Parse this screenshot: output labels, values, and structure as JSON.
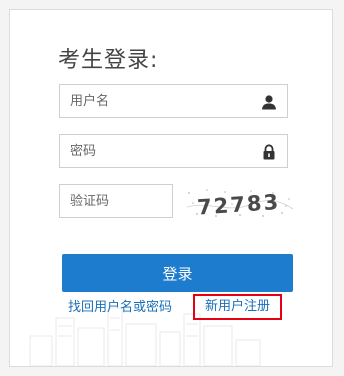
{
  "login": {
    "title": "考生登录:",
    "username_placeholder": "用户名",
    "password_placeholder": "密码",
    "captcha_placeholder": "验证码",
    "captcha_text": "72783",
    "submit_label": "登录",
    "find_account_label": "找回用户名或密码",
    "register_label": "新用户注册"
  },
  "colors": {
    "primary": "#1d7ccd",
    "highlight_border": "#e60012",
    "link": "#1a6fb8"
  }
}
